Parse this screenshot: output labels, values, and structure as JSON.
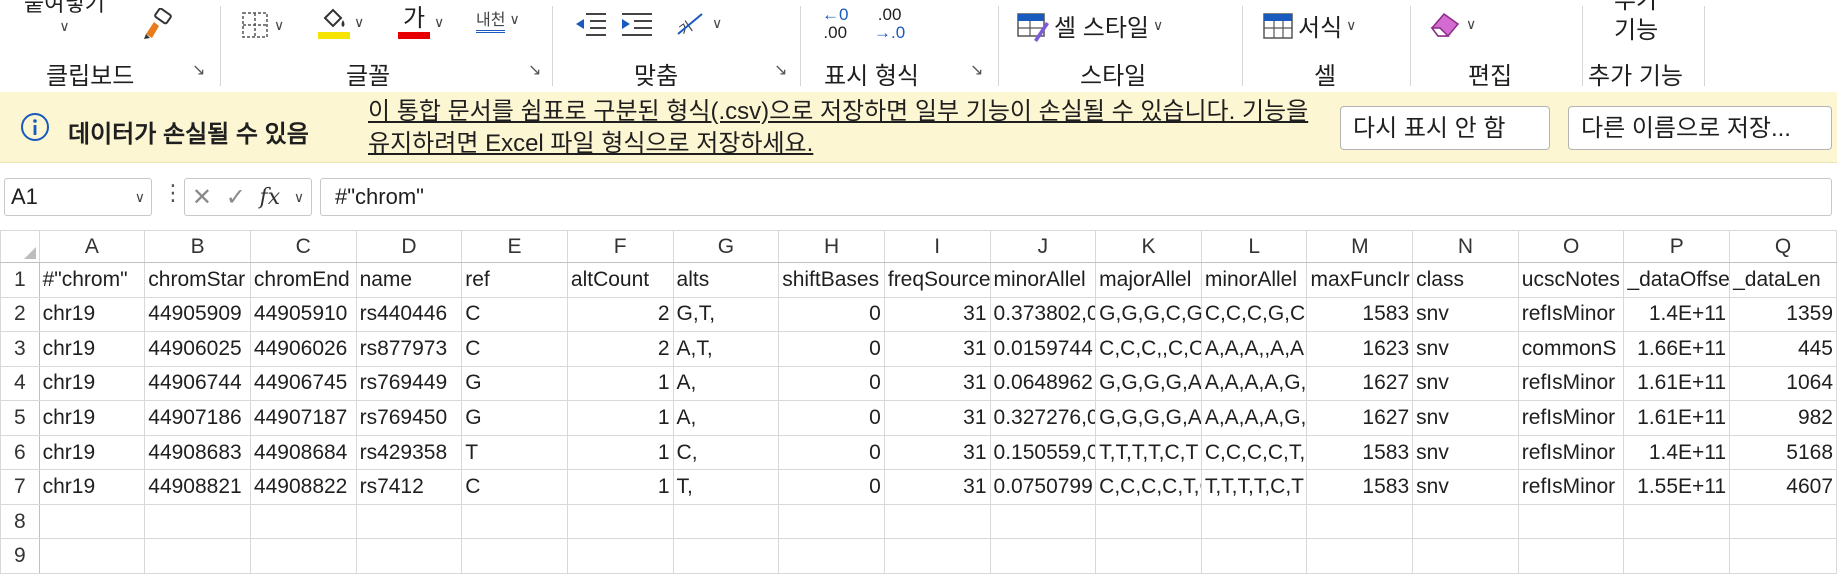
{
  "ribbon": {
    "paste_label": "붙여넣기",
    "groups": {
      "clipboard": "클립보드",
      "font": "글꼴",
      "alignment": "맞춤",
      "number": "표시 형식",
      "styles": "스타일",
      "cells": "셀",
      "editing": "편집",
      "addins": "추가 기능"
    },
    "font_color_glyph": "가",
    "phonetic_glyph": "내천",
    "inc_decimal_top": "←0",
    "inc_decimal_bottom": ".00",
    "dec_decimal_top": ".00",
    "dec_decimal_bottom": "→.0",
    "cell_styles_label": "셀 스타일",
    "format_label": "서식",
    "addins_btn_line1": "추가",
    "addins_btn_line2": "기능",
    "colors": {
      "highlight": "#f5e400",
      "font_red": "#e60000",
      "accent": "#185abd"
    }
  },
  "message_bar": {
    "title": "데이터가 손실될 수 있음",
    "body": "이 통합 문서를 쉼표로 구분된 형식(.csv)으로 저장하면 일부 기능이 손실될 수 있습니다. 기능을 유지하려면 Excel 파일 형식으로 저장하세요.",
    "dont_show_again": "다시 표시 안 함",
    "save_as": "다른 이름으로 저장..."
  },
  "formula_bar": {
    "name_box": "A1",
    "fx": "fx",
    "formula": "#\"chrom\""
  },
  "grid": {
    "columns": [
      "A",
      "B",
      "C",
      "D",
      "E",
      "F",
      "G",
      "H",
      "I",
      "J",
      "K",
      "L",
      "M",
      "N",
      "O",
      "P",
      "Q"
    ],
    "row_numbers": [
      "1",
      "2",
      "3",
      "4",
      "5",
      "6",
      "7",
      "8",
      "9"
    ],
    "rows": [
      [
        "#\"chrom\"",
        "chromStar",
        "chromEnd",
        "name",
        "ref",
        "altCount",
        "alts",
        "shiftBases",
        "freqSource",
        "minorAllel",
        "majorAllel",
        "minorAllel",
        "maxFuncIr",
        "class",
        "ucscNotes",
        "_dataOffse",
        "_dataLen"
      ],
      [
        "chr19",
        "44905909",
        "44905910",
        "rs440446",
        "C",
        "2",
        "G,T,",
        "0",
        "31",
        "0.373802,0",
        "G,G,G,C,G,",
        "C,C,C,G,C,C",
        "1583",
        "snv",
        "refIsMinor",
        "1.4E+11",
        "1359"
      ],
      [
        "chr19",
        "44906025",
        "44906026",
        "rs877973",
        "C",
        "2",
        "A,T,",
        "0",
        "31",
        "0.0159744",
        "C,C,C,,C,C,",
        "A,A,A,,A,A,",
        "1623",
        "snv",
        "commonS",
        "1.66E+11",
        "445"
      ],
      [
        "chr19",
        "44906744",
        "44906745",
        "rs769449",
        "G",
        "1",
        "A,",
        "0",
        "31",
        "0.0648962",
        "G,G,G,G,A,",
        "A,A,A,A,G,A",
        "1627",
        "snv",
        "refIsMinor",
        "1.61E+11",
        "1064"
      ],
      [
        "chr19",
        "44907186",
        "44907187",
        "rs769450",
        "G",
        "1",
        "A,",
        "0",
        "31",
        "0.327276,0",
        "G,G,G,G,A,",
        "A,A,A,A,G,A",
        "1627",
        "snv",
        "refIsMinor",
        "1.61E+11",
        "982"
      ],
      [
        "chr19",
        "44908683",
        "44908684",
        "rs429358",
        "T",
        "1",
        "C,",
        "0",
        "31",
        "0.150559,0",
        "T,T,T,T,C,T",
        "C,C,C,C,T,C",
        "1583",
        "snv",
        "refIsMinor",
        "1.4E+11",
        "5168"
      ],
      [
        "chr19",
        "44908821",
        "44908822",
        "rs7412",
        "C",
        "1",
        "T,",
        "0",
        "31",
        "0.0750799",
        "C,C,C,C,T,C",
        "T,T,T,T,C,T",
        "1583",
        "snv",
        "refIsMinor",
        "1.55E+11",
        "4607"
      ],
      [
        "",
        "",
        "",
        "",
        "",
        "",
        "",
        "",
        "",
        "",
        "",
        "",
        "",
        "",
        "",
        "",
        ""
      ],
      [
        "",
        "",
        "",
        "",
        "",
        "",
        "",
        "",
        "",
        "",
        "",
        "",
        "",
        "",
        "",
        "",
        ""
      ]
    ]
  }
}
